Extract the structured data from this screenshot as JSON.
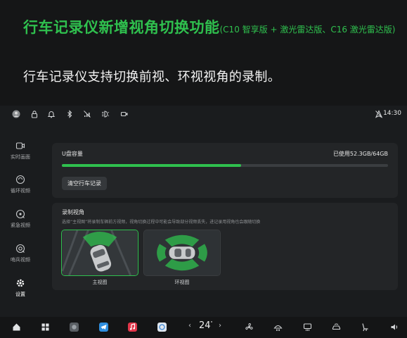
{
  "banner": {
    "headline": "行车记录仪新增视角切换功能",
    "headline_note": "(C10 智享版 + 激光雷达版、C16 激光雷达版)",
    "subline": "行车记录仪支持切换前视、环视视角的录制。"
  },
  "statusbar": {
    "icons": [
      "user-avatar-icon",
      "lock-icon",
      "bell-icon",
      "bluetooth-icon",
      "no-signal-icon",
      "headlight-icon",
      "camera-record-icon",
      "no-gps-icon"
    ],
    "time": "14:30"
  },
  "sidebar": {
    "items": [
      {
        "label": "实时画面",
        "icon": "live-video-icon",
        "active": false
      },
      {
        "label": "循环视频",
        "icon": "loop-video-icon",
        "active": false
      },
      {
        "label": "紧急视频",
        "icon": "emergency-video-icon",
        "active": false
      },
      {
        "label": "哨兵视频",
        "icon": "sentry-video-icon",
        "active": false
      },
      {
        "label": "设置",
        "icon": "settings-icon",
        "active": true
      }
    ]
  },
  "usb": {
    "title": "U盘容量",
    "used_text": "已使用52.3GB/64GB",
    "used_fraction": 0.55,
    "clear_button": "清空行车记录"
  },
  "recording": {
    "title": "录制视角",
    "description": "选择“主视图”将录制车辆前方视频，视角切换过程中可能会导致部分视频丢失，进记录用视角也会跟随切换",
    "options": [
      {
        "label": "主视图",
        "selected": true
      },
      {
        "label": "环视图",
        "selected": false
      }
    ]
  },
  "dock": {
    "temperature": "24",
    "temperature_unit": "°",
    "left_arrow": "‹",
    "right_arrow": "›",
    "items": [
      "home-icon",
      "apps-grid-icon",
      "camera-app-icon",
      "telegram-app-icon",
      "music-app-icon",
      "browser-app-icon",
      "fan-icon",
      "front-defrost-icon",
      "rear-defrost-icon",
      "car-air-icon",
      "seat-icon",
      "volume-icon"
    ]
  },
  "colors": {
    "accent": "#2fc04e",
    "background": "#1a1c1e",
    "panel": "#232527"
  }
}
